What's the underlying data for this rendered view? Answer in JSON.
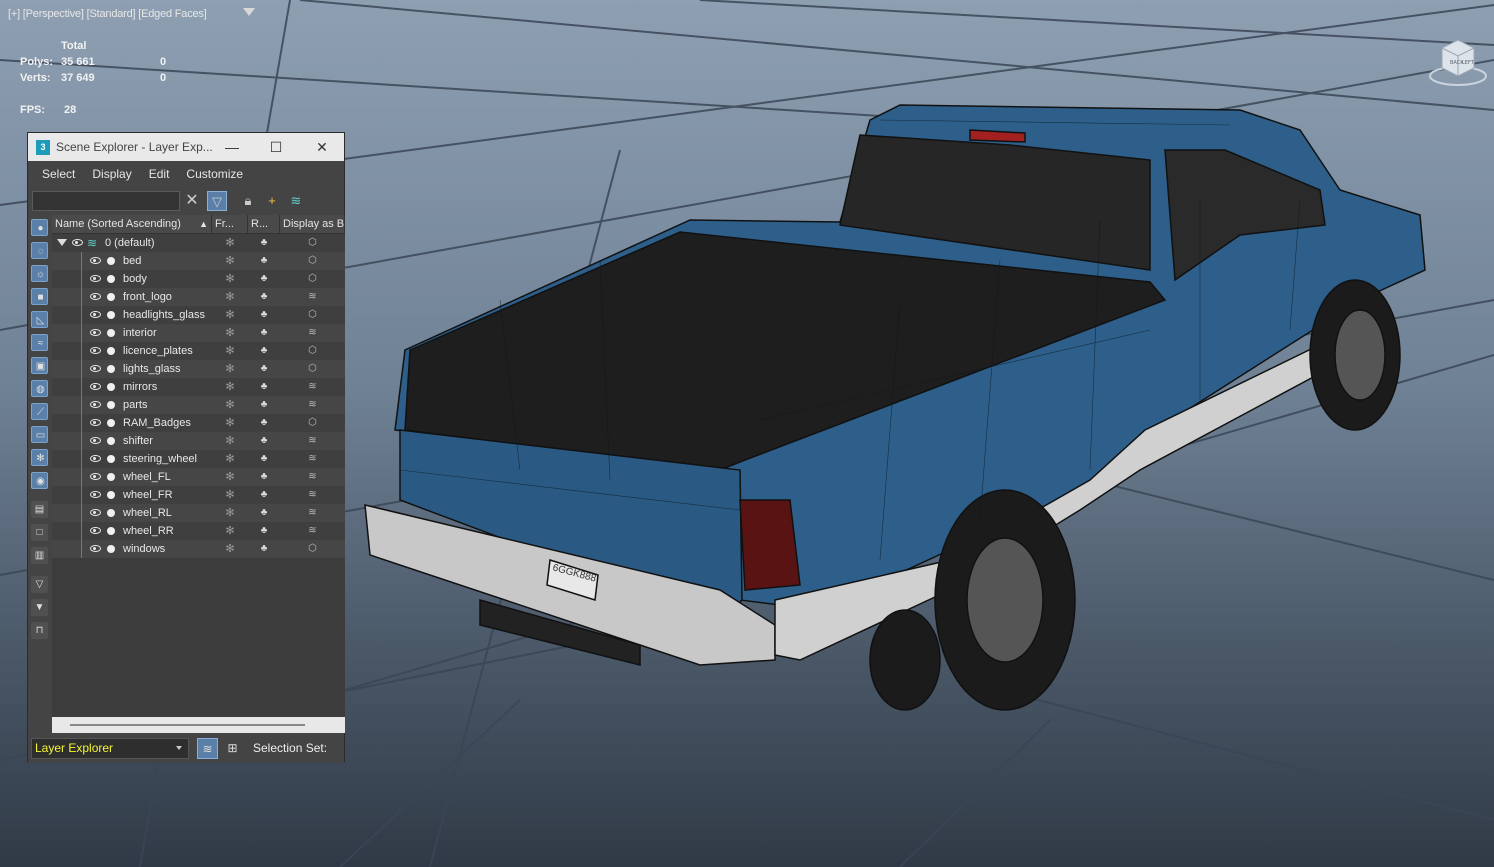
{
  "viewport": {
    "label": "[+] [Perspective] [Standard] [Edged Faces]",
    "filter_icon": "filter-icon",
    "stats": {
      "total_label": "Total",
      "polys_label": "Polys:",
      "polys_total": "35 661",
      "polys_selected": "0",
      "verts_label": "Verts:",
      "verts_total": "37 649",
      "verts_selected": "0",
      "fps_label": "FPS:",
      "fps_value": "28"
    },
    "viewcube_labels": {
      "back": "BACK",
      "left": "LEFT"
    },
    "license_plate": "6GGK888",
    "truck_body_color": "#2d5f8a",
    "background_top": "#8e9fb2",
    "background_bottom": "#303a46"
  },
  "scene_explorer": {
    "title": "Scene Explorer - Layer Exp...",
    "app_icon_text": "3",
    "window_buttons": {
      "minimize": "—",
      "maximize": "☐",
      "close": "✕"
    },
    "menu": [
      "Select",
      "Display",
      "Edit",
      "Customize"
    ],
    "search": {
      "value": "",
      "placeholder": ""
    },
    "toolbar_icons": [
      "clear-search-icon",
      "filter-icon",
      "lock-icon",
      "add-layer-icon",
      "layers-icon"
    ],
    "columns": {
      "name": "Name (Sorted Ascending)",
      "sort_glyph": "▲",
      "frozen": "Fr...",
      "render": "R...",
      "display": "Display as Bo"
    },
    "root_layer": "0 (default)",
    "layers": [
      {
        "name": "bed",
        "display": "box"
      },
      {
        "name": "body",
        "display": "box"
      },
      {
        "name": "front_logo",
        "display": "layers"
      },
      {
        "name": "headlights_glass",
        "display": "box"
      },
      {
        "name": "interior",
        "display": "layers"
      },
      {
        "name": "licence_plates",
        "display": "box"
      },
      {
        "name": "lights_glass",
        "display": "box"
      },
      {
        "name": "mirrors",
        "display": "layers"
      },
      {
        "name": "parts",
        "display": "layers"
      },
      {
        "name": "RAM_Badges",
        "display": "box"
      },
      {
        "name": "shifter",
        "display": "layers"
      },
      {
        "name": "steering_wheel",
        "display": "layers"
      },
      {
        "name": "wheel_FL",
        "display": "layers"
      },
      {
        "name": "wheel_FR",
        "display": "layers"
      },
      {
        "name": "wheel_RL",
        "display": "layers"
      },
      {
        "name": "wheel_RR",
        "display": "layers"
      },
      {
        "name": "windows",
        "display": "box"
      }
    ],
    "explorer_dropdown": "Layer Explorer",
    "selection_set_label": "Selection Set:",
    "accent": "#5a7fa8",
    "dropdown_text_color": "#f5f530"
  }
}
